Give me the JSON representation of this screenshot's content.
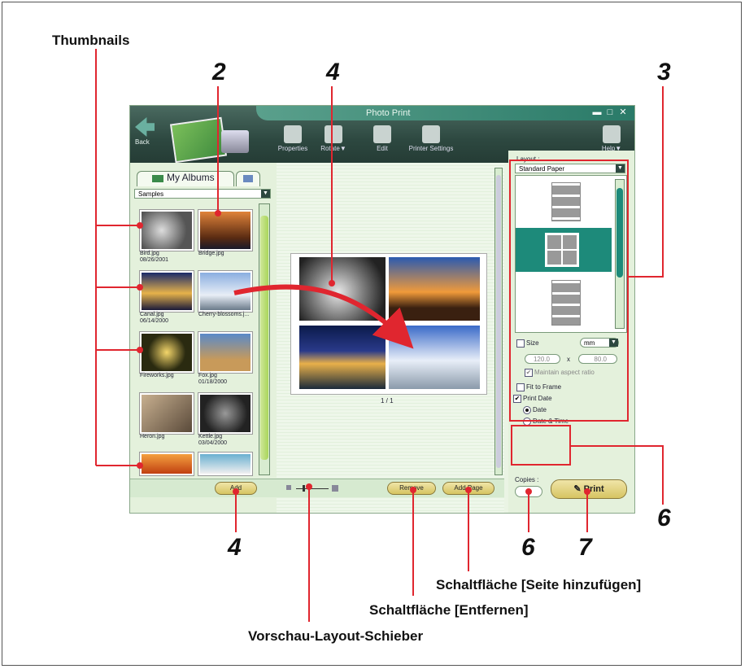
{
  "callouts": {
    "thumbnails": "Thumbnails",
    "n2": "2",
    "n4_top": "4",
    "n3": "3",
    "n4_bottom": "4",
    "n6_right": "6",
    "n6_bottom": "6",
    "n7": "7"
  },
  "captions": {
    "add_page": "Schaltfläche [Seite hinzufügen]",
    "remove": "Schaltfläche [Entfernen]",
    "slider": "Vorschau-Layout-Schieber"
  },
  "window": {
    "title": "Photo Print",
    "back": "Back",
    "help": "Help▼",
    "toolbar": [
      "Properties",
      "Rotate▼",
      "Edit",
      "Printer Settings"
    ]
  },
  "left": {
    "tab_my_albums": "My Albums",
    "album_select": "Samples",
    "thumbnails": [
      {
        "name": "Bird.jpg",
        "date": "08/26/2001"
      },
      {
        "name": "Bridge.jpg",
        "date": ""
      },
      {
        "name": "Canal.jpg",
        "date": "06/14/2000"
      },
      {
        "name": "Cherry-blossoms.j...",
        "date": ""
      },
      {
        "name": "Fireworks.jpg",
        "date": ""
      },
      {
        "name": "Fox.jpg",
        "date": "01/18/2000"
      },
      {
        "name": "Heron.jpg",
        "date": ""
      },
      {
        "name": "Kettle.jpg",
        "date": "03/04/2000"
      }
    ],
    "add_button": "Add"
  },
  "center": {
    "page_indicator": "1 / 1",
    "remove_button": "Remove",
    "add_page_button": "Add Page"
  },
  "right": {
    "layout_label": "Layout :",
    "paper_select": "Standard Paper",
    "size_label": "Size",
    "unit_select": "mm",
    "width_value": "120.0",
    "height_value": "80.0",
    "times": "x",
    "maintain_aspect": "Maintain aspect ratio",
    "fit_to_frame": "Fit to Frame",
    "print_date": "Print Date",
    "date": "Date",
    "date_time": "Date & Time",
    "copies_label": "Copies :",
    "copies_value": "1",
    "print_button": "Print"
  },
  "colors": {
    "callout_red": "#e0262f",
    "window_dark": "#2d4840",
    "teal": "#1d8a7a",
    "scroll_green": "#a9d55a"
  }
}
